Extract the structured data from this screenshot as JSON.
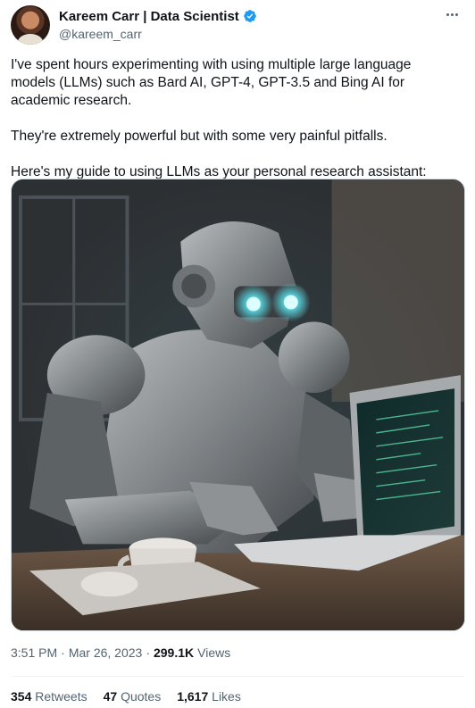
{
  "author": {
    "display_name": "Kareem Carr | Data Scientist",
    "handle": "@kareem_carr",
    "verified_color": "#1d9bf0"
  },
  "tweet": {
    "paragraphs": [
      "I've spent hours experimenting with using multiple large language models (LLMs) such as Bard AI, GPT-4, GPT-3.5 and Bing AI for academic research.",
      "They're extremely powerful but with some very painful pitfalls.",
      "Here's my guide to using LLMs as your personal research assistant:"
    ],
    "media_icon": "robot-at-laptop-image"
  },
  "meta": {
    "time": "3:51 PM",
    "separator": "·",
    "date": "Mar 26, 2023",
    "separator2": "·",
    "views_count": "299.1K",
    "views_label": "Views"
  },
  "stats": {
    "retweets_count": "354",
    "retweets_label": "Retweets",
    "quotes_count": "47",
    "quotes_label": "Quotes",
    "likes_count": "1,617",
    "likes_label": "Likes"
  },
  "icons": {
    "more": "more-horizontal-icon",
    "verified": "verified-badge-icon"
  }
}
